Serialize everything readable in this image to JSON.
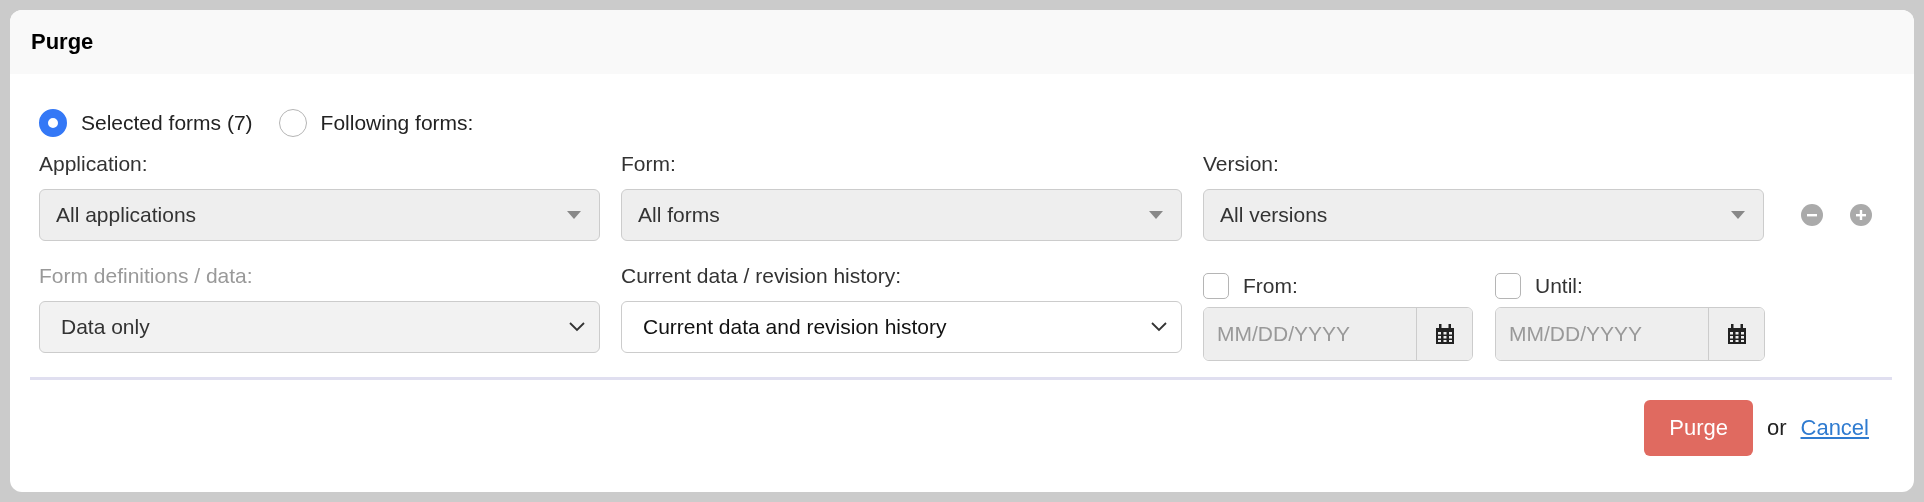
{
  "dialog": {
    "title": "Purge"
  },
  "scope_options": [
    {
      "label": "Selected forms (7)",
      "selected": true
    },
    {
      "label": "Following forms:",
      "selected": false
    }
  ],
  "filters": [
    {
      "label": "Application:",
      "value": "All applications",
      "disabled": true
    },
    {
      "label": "Form:",
      "value": "All forms",
      "disabled": true
    },
    {
      "label": "Version:",
      "value": "All versions",
      "disabled": true
    }
  ],
  "options": [
    {
      "kind": "select",
      "label": "Form definitions / data:",
      "value": "Data only",
      "disabled": true
    },
    {
      "kind": "select",
      "label": "Current data / revision history:",
      "value": "Current data and revision history",
      "disabled": false
    },
    {
      "kind": "date",
      "label": "From:",
      "checked": false,
      "placeholder": "MM/DD/YYYY"
    },
    {
      "kind": "date",
      "label": "Until:",
      "checked": false,
      "placeholder": "MM/DD/YYYY"
    }
  ],
  "actions": {
    "primary": "Purge",
    "separator": "or",
    "cancel": "Cancel"
  }
}
